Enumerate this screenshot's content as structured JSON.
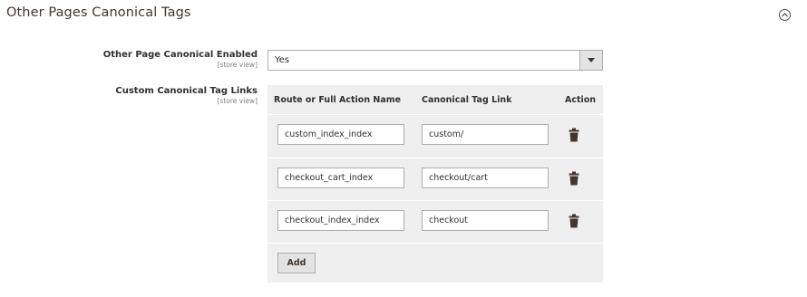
{
  "section": {
    "title": "Other Pages Canonical Tags"
  },
  "enabled_field": {
    "label": "Other Page Canonical Enabled",
    "scope": "[store view]",
    "value": "Yes"
  },
  "links_field": {
    "label": "Custom Canonical Tag Links",
    "scope": "[store view]"
  },
  "grid": {
    "columns": [
      "Route or Full Action Name",
      "Canonical Tag Link",
      "Action"
    ],
    "rows": [
      {
        "route": "custom_index_index",
        "link": "custom/"
      },
      {
        "route": "checkout_cart_index",
        "link": "checkout/cart"
      },
      {
        "route": "checkout_index_index",
        "link": "checkout"
      }
    ],
    "add_label": "Add"
  },
  "icons": {
    "collapse": "chevron-up-circle-icon",
    "delete": "trash-icon",
    "dropdown": "caret-down-icon"
  },
  "colors": {
    "grid_bg": "#efefef",
    "border": "#adadad",
    "title": "#41362f"
  }
}
